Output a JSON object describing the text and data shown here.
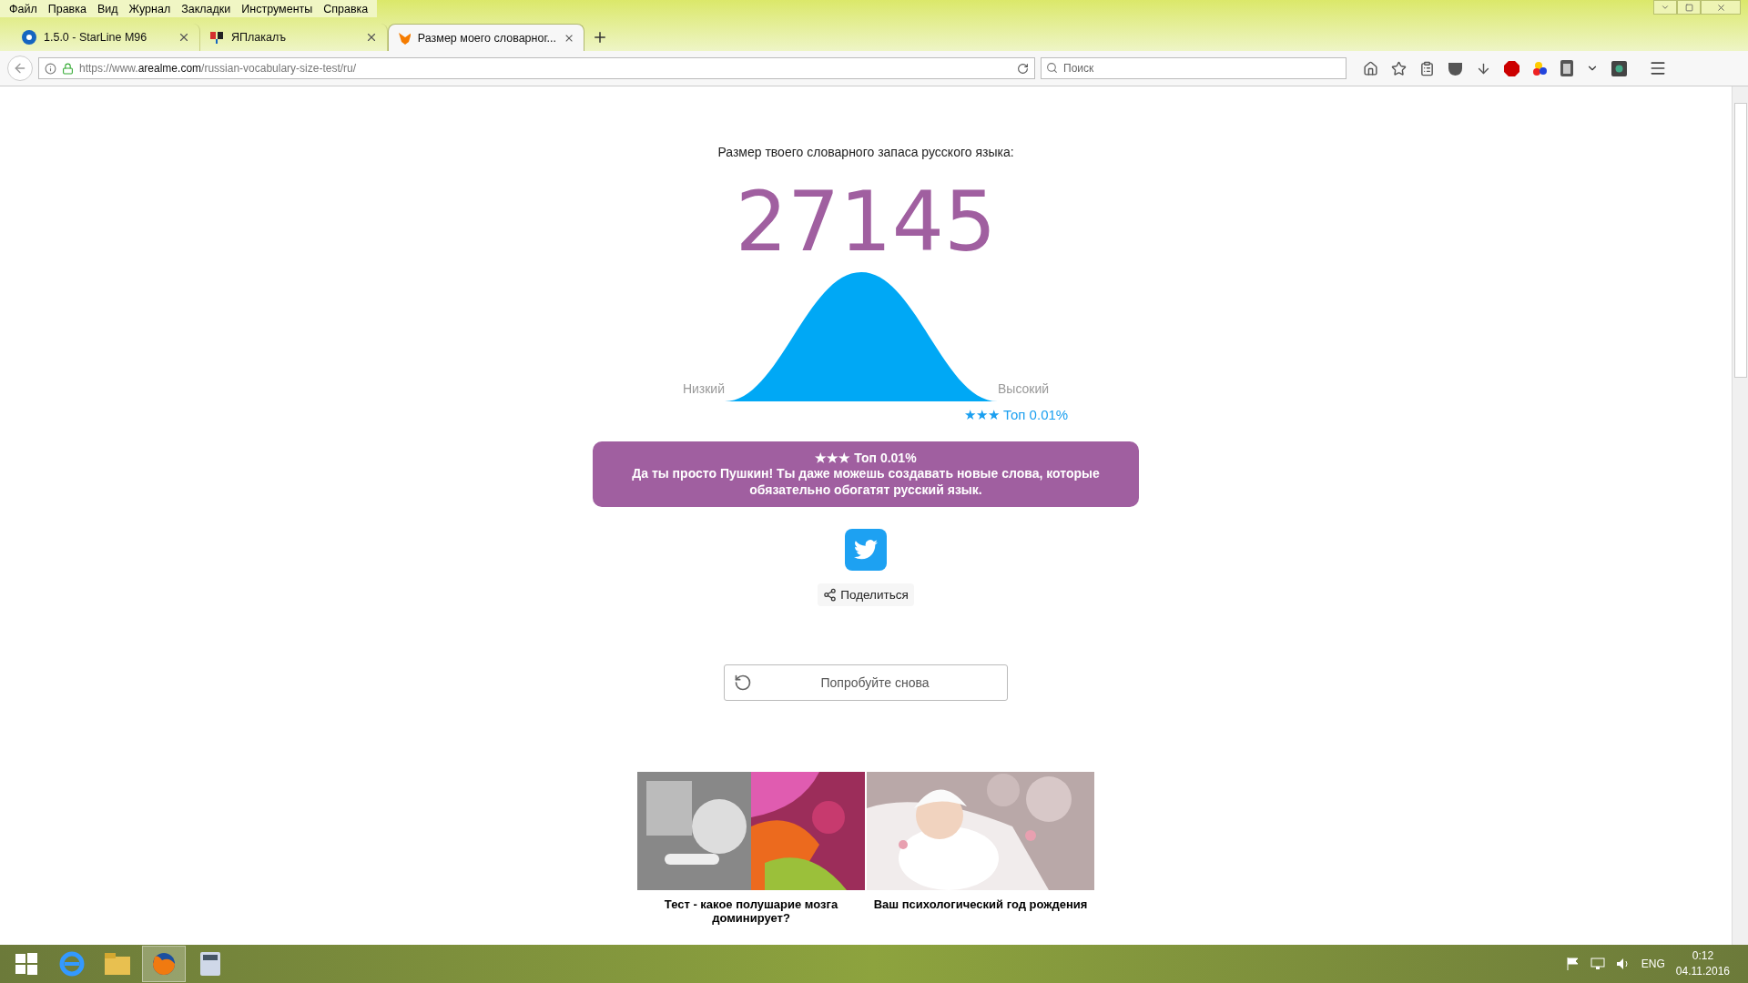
{
  "menu": [
    "Файл",
    "Правка",
    "Вид",
    "Журнал",
    "Закладки",
    "Инструменты",
    "Справка"
  ],
  "tabs": [
    {
      "label": "1.5.0 - StarLine M96",
      "selected": false,
      "kind": "starline"
    },
    {
      "label": "ЯПлакалъ",
      "selected": false,
      "kind": "yaplakal"
    },
    {
      "label": "Размер моего словарног...",
      "selected": true,
      "kind": "fox"
    }
  ],
  "address": {
    "prefix": "https://www.",
    "domain": "arealme.com",
    "path": "/russian-vocabulary-size-test/ru/"
  },
  "search": {
    "placeholder": "Поиск"
  },
  "page": {
    "subtitle": "Размер твоего словарного запаса русского языка:",
    "score": "27145",
    "low_label": "Низкий",
    "high_label": "Высокий",
    "rank": "★★★ Топ 0.01%",
    "result_title": "★★★ Топ 0.01%",
    "result_text": "Да ты просто Пушкин! Ты даже можешь создавать новые слова, которые обязательно обогатят русский язык.",
    "share": "Поделиться",
    "retry": "Попробуйте снова",
    "cards": [
      {
        "title": "Тест - какое полушарие мозга доминирует?",
        "kind": "picture"
      },
      {
        "title": "Ваш психологический год рождения",
        "kind": "picture"
      }
    ]
  },
  "taskbar": {
    "language": "ENG",
    "time": "0:12",
    "date": "04.11.2016"
  }
}
